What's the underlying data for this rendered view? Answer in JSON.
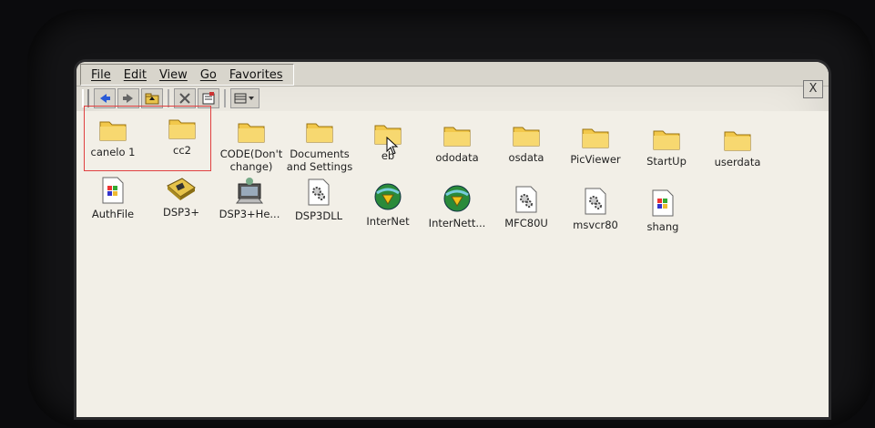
{
  "menu": {
    "items": [
      "File",
      "Edit",
      "View",
      "Go",
      "Favorites"
    ]
  },
  "window": {
    "close_label": "X"
  },
  "toolbar": {
    "buttons": [
      "back-icon",
      "forward-icon",
      "up-folder-icon",
      "delete-icon",
      "properties-icon",
      "view-menu-icon"
    ]
  },
  "files": {
    "row1": [
      {
        "label": "canelo 1",
        "icon": "folder-icon"
      },
      {
        "label": "cc2",
        "icon": "folder-icon"
      },
      {
        "label": "CODE(Don't\nchange)",
        "icon": "folder-icon"
      },
      {
        "label": "Documents\nand Settings",
        "icon": "folder-icon"
      },
      {
        "label": "eb",
        "icon": "folder-icon"
      },
      {
        "label": "ododata",
        "icon": "folder-icon"
      },
      {
        "label": "osdata",
        "icon": "folder-icon"
      },
      {
        "label": "PicViewer",
        "icon": "folder-icon"
      },
      {
        "label": "StartUp",
        "icon": "folder-icon"
      },
      {
        "label": "userdata",
        "icon": "folder-icon"
      }
    ],
    "row2": [
      {
        "label": "AuthFile",
        "icon": "windows-file-icon"
      },
      {
        "label": "DSP3+",
        "icon": "chip-icon"
      },
      {
        "label": "DSP3+He...",
        "icon": "installer-icon"
      },
      {
        "label": "DSP3DLL",
        "icon": "dll-gear-icon"
      },
      {
        "label": "InterNet",
        "icon": "globe-icon"
      },
      {
        "label": "InterNett...",
        "icon": "globe-icon"
      },
      {
        "label": "MFC80U",
        "icon": "dll-gear-icon"
      },
      {
        "label": "msvcr80",
        "icon": "dll-gear-icon"
      },
      {
        "label": "shang",
        "icon": "windows-file-icon"
      }
    ]
  },
  "colors": {
    "selection_border": "#e04040",
    "folder": "#f2c84b",
    "background": "#f2efe7"
  }
}
